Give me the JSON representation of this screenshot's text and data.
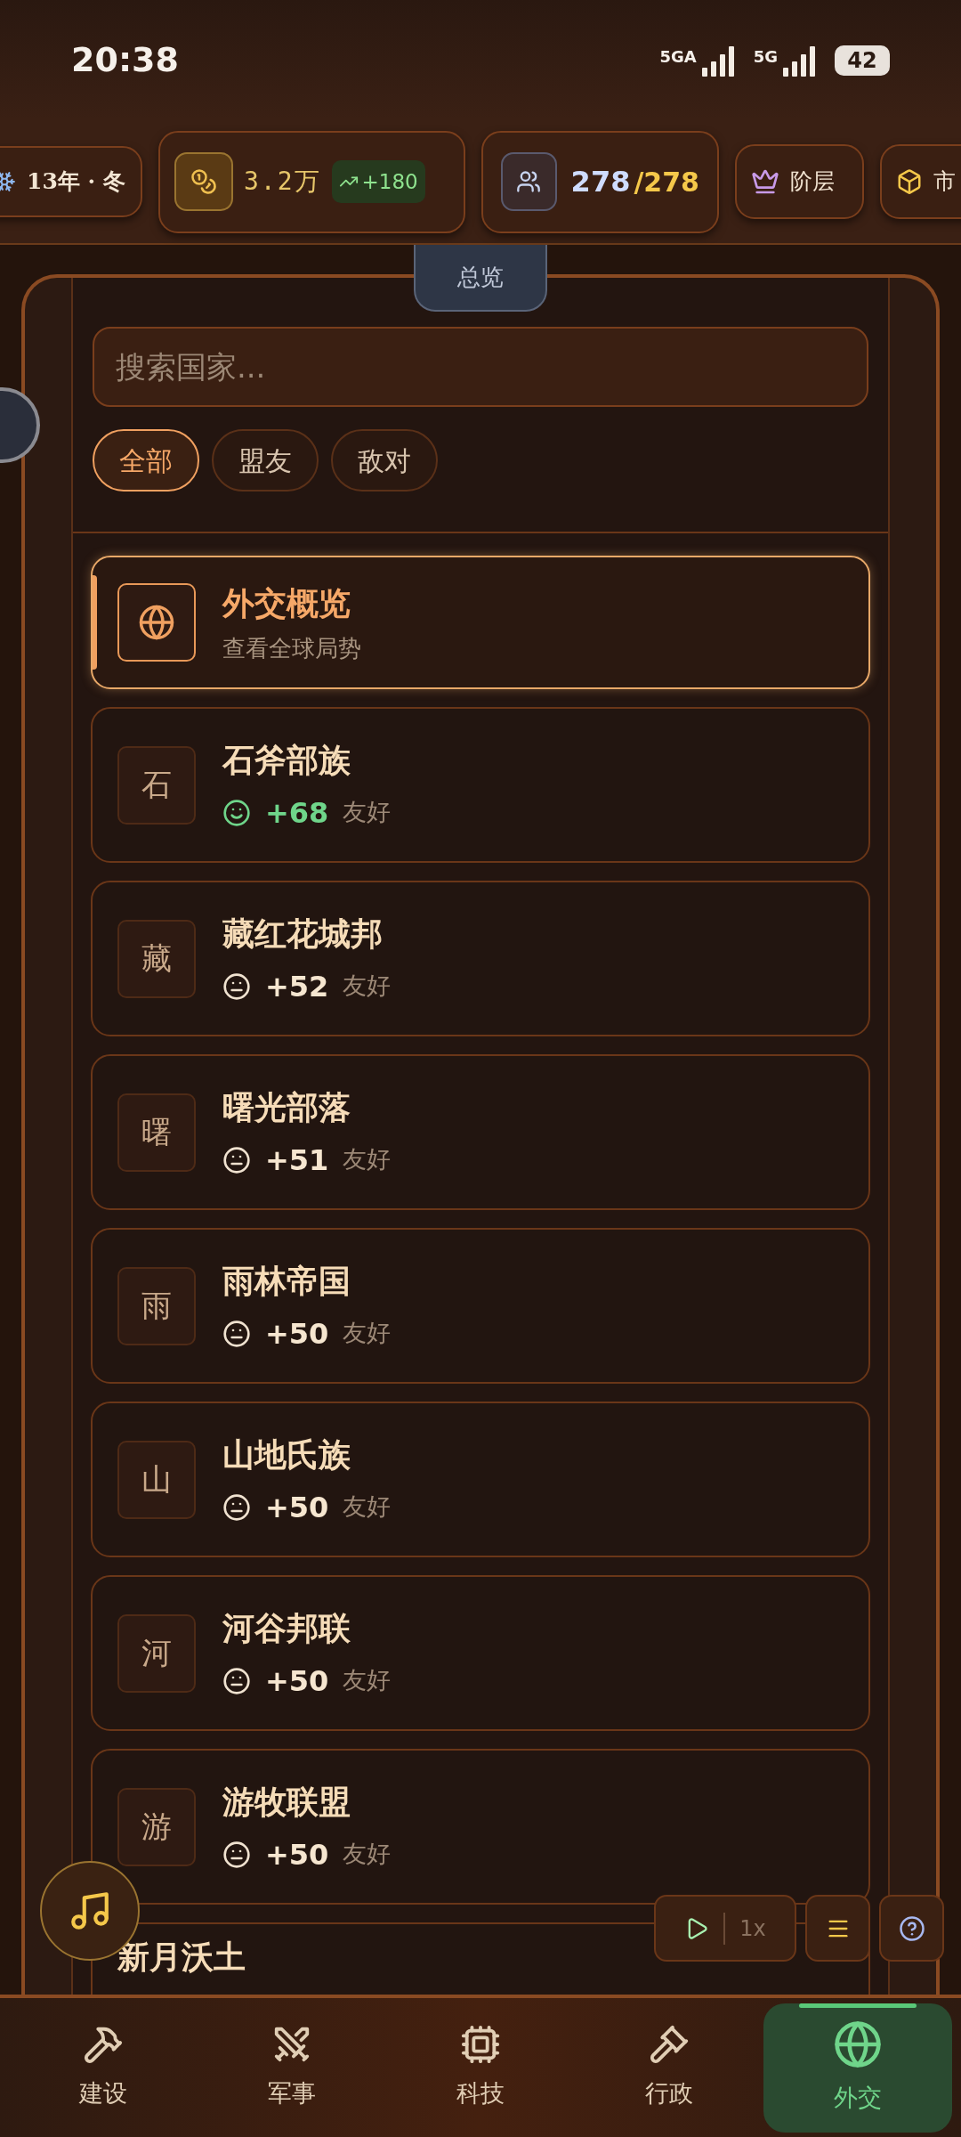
{
  "status_bar": {
    "time": "20:38",
    "networks": [
      {
        "label": "5GA"
      },
      {
        "label": "5G"
      }
    ],
    "battery": "42"
  },
  "resources": [
    {
      "kind": "season",
      "text": "13年 · 冬"
    },
    {
      "kind": "gold",
      "value": "3.2万",
      "delta": "+180"
    },
    {
      "kind": "population",
      "value": "278",
      "capacity": "/278"
    },
    {
      "kind": "class",
      "text": "阶层"
    },
    {
      "kind": "market",
      "text": "市"
    }
  ],
  "panel_tab": "总览",
  "search": {
    "placeholder": "搜索国家..."
  },
  "filters": [
    {
      "label": "全部",
      "selected": true
    },
    {
      "label": "盟友",
      "selected": false
    },
    {
      "label": "敌对",
      "selected": false
    }
  ],
  "overview": {
    "title": "外交概览",
    "subtitle": "查看全球局势",
    "selected": true
  },
  "nations": [
    {
      "initial": "石",
      "name": "石斧部族",
      "kind": "happy",
      "score": "+68",
      "relation": "友好"
    },
    {
      "initial": "藏",
      "name": "藏红花城邦",
      "kind": "neutral",
      "score": "+52",
      "relation": "友好"
    },
    {
      "initial": "曙",
      "name": "曙光部落",
      "kind": "neutral",
      "score": "+51",
      "relation": "友好"
    },
    {
      "initial": "雨",
      "name": "雨林帝国",
      "kind": "neutral",
      "score": "+50",
      "relation": "友好"
    },
    {
      "initial": "山",
      "name": "山地氏族",
      "kind": "neutral",
      "score": "+50",
      "relation": "友好"
    },
    {
      "initial": "河",
      "name": "河谷邦联",
      "kind": "neutral",
      "score": "+50",
      "relation": "友好"
    },
    {
      "initial": "游",
      "name": "游牧联盟",
      "kind": "neutral",
      "score": "+50",
      "relation": "友好"
    },
    {
      "name": "新月沃土"
    }
  ],
  "speed_controls": {
    "speed": "1x",
    "playing": false
  },
  "nav": [
    {
      "label": "建设",
      "selected": false
    },
    {
      "label": "军事",
      "selected": false
    },
    {
      "label": "科技",
      "selected": false
    },
    {
      "label": "行政",
      "selected": false
    },
    {
      "label": "外交",
      "selected": true
    }
  ]
}
